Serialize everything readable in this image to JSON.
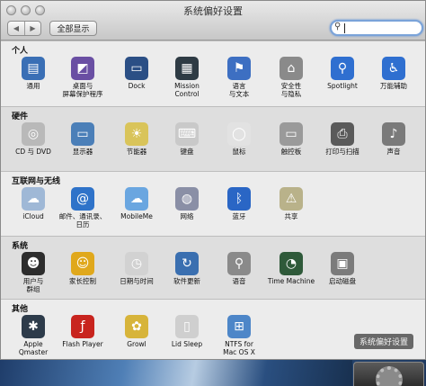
{
  "window": {
    "title": "系统偏好设置",
    "show_all_label": "全部显示",
    "back_glyph": "◀",
    "forward_glyph": "▶",
    "search": {
      "placeholder": "",
      "value": "",
      "icon": "search-icon"
    }
  },
  "sections": [
    {
      "title": "个人",
      "panes": [
        {
          "label": "通用",
          "icon": "general-icon",
          "color": "#3a6fb5"
        },
        {
          "label": "桌面与\n屏幕保护程序",
          "icon": "desktop-screensaver-icon",
          "color": "#6a4fa3"
        },
        {
          "label": "Dock",
          "icon": "dock-icon",
          "color": "#2b4f85"
        },
        {
          "label": "Mission\nControl",
          "icon": "mission-control-icon",
          "color": "#2e3b44"
        },
        {
          "label": "语言\n与文本",
          "icon": "language-text-icon",
          "color": "#3d6fc2"
        },
        {
          "label": "安全性\n与隐私",
          "icon": "security-privacy-icon",
          "color": "#8a8a8a"
        },
        {
          "label": "Spotlight",
          "icon": "spotlight-icon",
          "color": "#2f6fd0"
        },
        {
          "label": "万能辅助",
          "icon": "universal-access-icon",
          "color": "#2f6fd0"
        }
      ]
    },
    {
      "title": "硬件",
      "panes": [
        {
          "label": "CD 与 DVD",
          "icon": "cd-dvd-icon",
          "color": "#b9b9b9"
        },
        {
          "label": "显示器",
          "icon": "displays-icon",
          "color": "#4b7fb8"
        },
        {
          "label": "节能器",
          "icon": "energy-saver-icon",
          "color": "#d9c45a"
        },
        {
          "label": "键盘",
          "icon": "keyboard-icon",
          "color": "#c9c9c9"
        },
        {
          "label": "鼠标",
          "icon": "mouse-icon",
          "color": "#e2e2e2"
        },
        {
          "label": "触控板",
          "icon": "trackpad-icon",
          "color": "#9a9a9a"
        },
        {
          "label": "打印与扫描",
          "icon": "print-scan-icon",
          "color": "#5a5a5a"
        },
        {
          "label": "声音",
          "icon": "sound-icon",
          "color": "#7a7a7a"
        }
      ]
    },
    {
      "title": "互联网与无线",
      "panes": [
        {
          "label": "iCloud",
          "icon": "icloud-icon",
          "color": "#9fb8d6"
        },
        {
          "label": "邮件、通讯录、\n日历",
          "icon": "mail-contacts-calendars-icon",
          "color": "#2f73c9"
        },
        {
          "label": "MobileMe",
          "icon": "mobileme-icon",
          "color": "#6aa6e0"
        },
        {
          "label": "网络",
          "icon": "network-icon",
          "color": "#8a8fa6"
        },
        {
          "label": "蓝牙",
          "icon": "bluetooth-icon",
          "color": "#2a66c5"
        },
        {
          "label": "共享",
          "icon": "sharing-icon",
          "color": "#b9b28a"
        }
      ]
    },
    {
      "title": "系统",
      "panes": [
        {
          "label": "用户与\n群组",
          "icon": "users-groups-icon",
          "color": "#2d2d2d"
        },
        {
          "label": "家长控制",
          "icon": "parental-controls-icon",
          "color": "#e0a81c"
        },
        {
          "label": "日期与时间",
          "icon": "date-time-icon",
          "color": "#d2d2d2"
        },
        {
          "label": "软件更新",
          "icon": "software-update-icon",
          "color": "#3a6fb0"
        },
        {
          "label": "语音",
          "icon": "speech-icon",
          "color": "#8a8a8a"
        },
        {
          "label": "Time Machine",
          "icon": "time-machine-icon",
          "color": "#2f5a3a"
        },
        {
          "label": "启动磁盘",
          "icon": "startup-disk-icon",
          "color": "#7b7b7b"
        }
      ]
    },
    {
      "title": "其他",
      "panes": [
        {
          "label": "Apple\nQmaster",
          "icon": "apple-qmaster-icon",
          "color": "#2d3b4a"
        },
        {
          "label": "Flash Player",
          "icon": "flash-player-icon",
          "color": "#c8241e"
        },
        {
          "label": "Growl",
          "icon": "growl-icon",
          "color": "#d7b43a"
        },
        {
          "label": "Lid Sleep",
          "icon": "lid-sleep-icon",
          "color": "#cfcfcf"
        },
        {
          "label": "NTFS for\nMac OS X",
          "icon": "ntfs-icon",
          "color": "#4d86c8"
        }
      ]
    }
  ],
  "dock": {
    "tooltip": "系统偏好设置",
    "icon": "system-preferences-icon"
  }
}
